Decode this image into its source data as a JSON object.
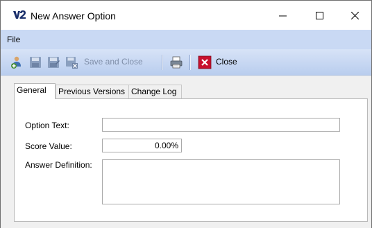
{
  "window": {
    "title": "New Answer Option",
    "app_icon": "v2-logo-icon",
    "controls": [
      "minimize-icon",
      "maximize-icon",
      "close-icon"
    ]
  },
  "menu": {
    "file_label": "File"
  },
  "toolbar": {
    "save_and_close_label": "Save and Close",
    "close_label": "Close",
    "icons": [
      "add-user-icon",
      "save-icon",
      "save-edit-icon",
      "save-delete-icon",
      "print-icon",
      "close-red-icon"
    ]
  },
  "tabs": [
    {
      "label": "General",
      "active": true
    },
    {
      "label": "Previous Versions",
      "active": false
    },
    {
      "label": "Change Log",
      "active": false
    }
  ],
  "form": {
    "option_text_label": "Option Text:",
    "option_text_value": "",
    "score_value_label": "Score Value:",
    "score_value_value": "0.00%",
    "answer_definition_label": "Answer Definition:",
    "answer_definition_value": ""
  },
  "colors": {
    "menubar": "#c9d9f4",
    "toolbar": "#c3d4f0",
    "close_red": "#c8102e"
  }
}
